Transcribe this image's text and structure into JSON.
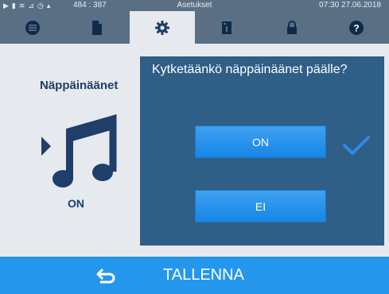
{
  "status": {
    "coords": "484 : 387",
    "title": "Asetukset",
    "datetime": "07:30  27.06.2018",
    "icons": [
      "play-icon",
      "file-icon",
      "steam-icon",
      "chart-icon",
      "clock-icon",
      "lock-icon"
    ]
  },
  "tabs": [
    {
      "icon": "list-icon"
    },
    {
      "icon": "document-icon"
    },
    {
      "icon": "gear-icon",
      "active": true
    },
    {
      "icon": "info-card-icon"
    },
    {
      "icon": "lock-icon"
    },
    {
      "icon": "help-icon"
    }
  ],
  "setting": {
    "title": "Näppäinäänet",
    "state": "ON"
  },
  "dialog": {
    "question": "Kytketäänkö näppäinäänet päälle?",
    "on_label": "ON",
    "off_label": "EI",
    "selected": "ON"
  },
  "footer": {
    "save_label": "TALLENNA"
  },
  "colors": {
    "header": "#5b6f84",
    "panel": "#2f5e86",
    "button": "#1686e5",
    "footer": "#2497ec",
    "check": "#2d8ae6"
  }
}
